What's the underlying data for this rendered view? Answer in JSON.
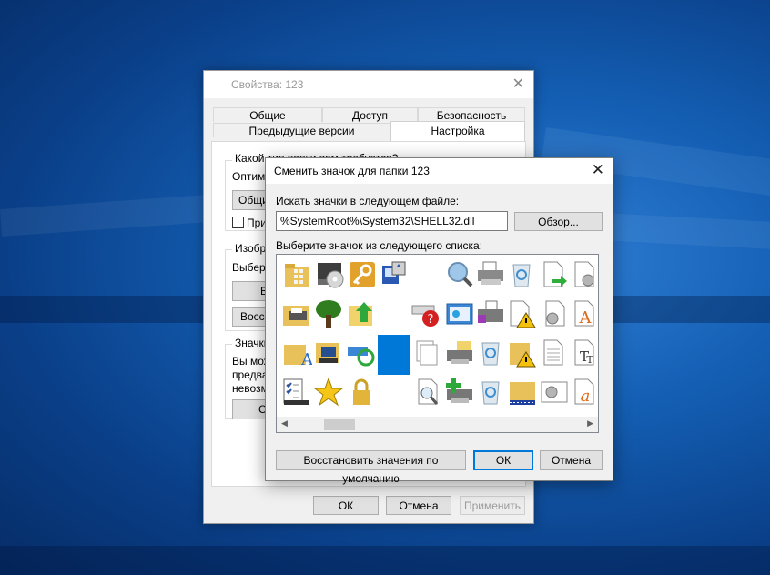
{
  "properties_window": {
    "title": "Свойства: 123",
    "tabs_row1": [
      "Общие",
      "Доступ",
      "Безопасность"
    ],
    "tabs_row2": [
      "Предыдущие версии",
      "Настройка"
    ],
    "active_tab": "Настройка",
    "group1_title": "Какой тип папки вам требуется?",
    "group1_label": "Оптими",
    "group1_select": "Общие",
    "group1_checkbox": "При",
    "group2_title": "Изобра",
    "group2_label": "Выбери",
    "group2_button1": "В",
    "group2_button2": "Восс",
    "group3_title": "Значки",
    "group3_line1": "Вы мож",
    "group3_line2": "предва",
    "group3_line3": "невозм",
    "group3_button": "С",
    "buttons": {
      "ok": "ОК",
      "cancel": "Отмена",
      "apply": "Применить"
    }
  },
  "change_icon_dialog": {
    "title": "Сменить значок для папки 123",
    "search_label": "Искать значки в следующем файле:",
    "file_path": "%SystemRoot%\\System32\\SHELL32.dll",
    "browse_button": "Обзор...",
    "list_label": "Выберите значок из следующего списка:",
    "restore_button": "Восстановить значения по умолчанию",
    "ok_button": "ОК",
    "cancel_button": "Отмена",
    "selected_icon": "blank-selected-icon",
    "icons_row1": [
      "folder-grid-icon",
      "dvd-drive-icon",
      "key-folder-icon",
      "network-computer-icon",
      "blank-icon",
      "search-magnifier-icon",
      "printer-icon",
      "recycle-bin-icon",
      "document-arrow-icon",
      "gear-document-icon"
    ],
    "icons_row2": [
      "printer-folder-icon",
      "tree-icon",
      "folder-up-arrow-icon",
      "blank-icon",
      "error-drive-icon",
      "control-panel-icon",
      "fax-printer-icon",
      "warning-document-icon",
      "gear-document-icon",
      "font-a-icon"
    ],
    "icons_row3": [
      "folder-font-icon",
      "computer-folder-icon",
      "sync-drive-icon",
      "blank-selected-icon",
      "stacked-pages-icon",
      "printer-folder-icon",
      "recycle-bin-icon",
      "warning-folder-icon",
      "text-document-icon",
      "truetype-font-icon"
    ],
    "icons_row4": [
      "checklist-icon",
      "star-icon",
      "padlock-icon",
      "blank-icon",
      "search-document-icon",
      "add-printer-icon",
      "recycle-bin-icon",
      "network-folder-icon",
      "gear-window-icon",
      "font-a-italic-icon"
    ]
  },
  "colors": {
    "accent": "#0078d7",
    "desktop": "#145fb4"
  }
}
